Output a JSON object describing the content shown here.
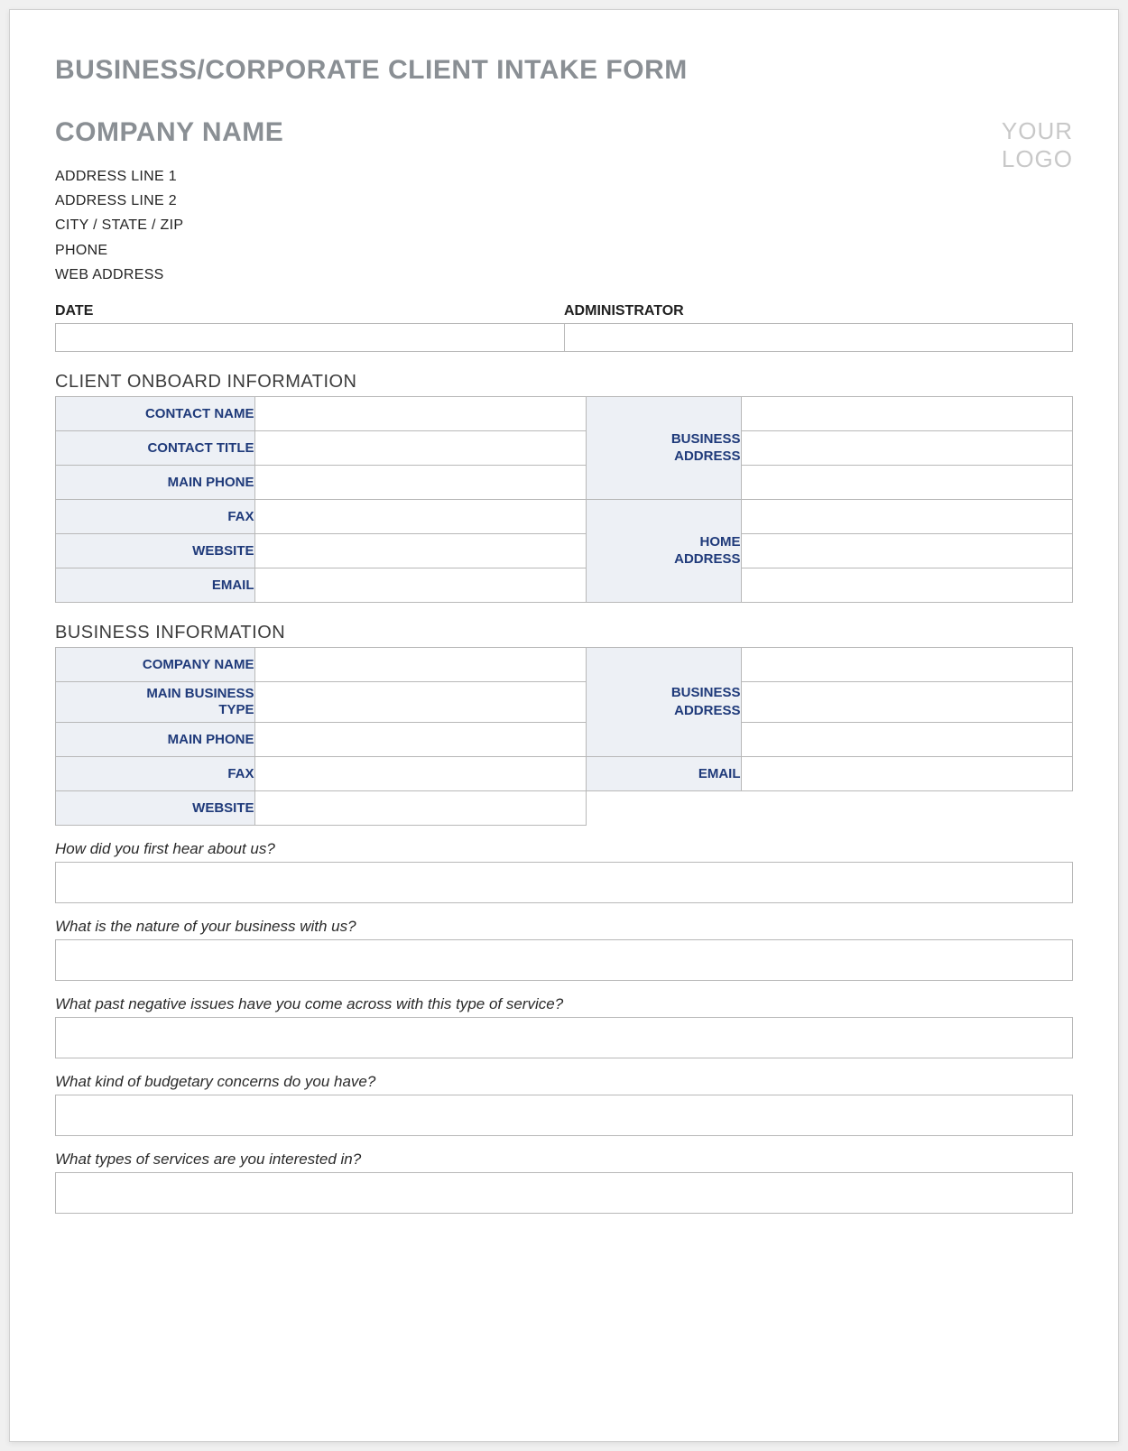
{
  "form_title": "BUSINESS/CORPORATE CLIENT INTAKE FORM",
  "company": {
    "name_label": "COMPANY NAME",
    "address1": "ADDRESS LINE 1",
    "address2": "ADDRESS LINE 2",
    "city_state_zip": "CITY / STATE / ZIP",
    "phone": "PHONE",
    "web": "WEB ADDRESS"
  },
  "logo": {
    "line1": "YOUR",
    "line2": "LOGO"
  },
  "date_admin": {
    "date_label": "DATE",
    "admin_label": "ADMINISTRATOR",
    "date_value": "",
    "admin_value": ""
  },
  "sections": {
    "client_onboard": "CLIENT ONBOARD INFORMATION",
    "business_info": "BUSINESS INFORMATION"
  },
  "client_onboard": {
    "contact_name_label": "CONTACT NAME",
    "contact_title_label": "CONTACT TITLE",
    "main_phone_label": "MAIN PHONE",
    "fax_label": "FAX",
    "website_label": "WEBSITE",
    "email_label": "EMAIL",
    "business_address_label": "BUSINESS\nADDRESS",
    "home_address_label": "HOME\nADDRESS",
    "contact_name": "",
    "contact_title": "",
    "main_phone": "",
    "fax": "",
    "website": "",
    "email": "",
    "business_address_1": "",
    "business_address_2": "",
    "business_address_3": "",
    "home_address_1": "",
    "home_address_2": "",
    "home_address_3": ""
  },
  "business_info": {
    "company_name_label": "COMPANY NAME",
    "main_business_type_label": "MAIN BUSINESS\nTYPE",
    "main_phone_label": "MAIN PHONE",
    "fax_label": "FAX",
    "website_label": "WEBSITE",
    "business_address_label": "BUSINESS\nADDRESS",
    "email_label": "EMAIL",
    "company_name": "",
    "main_business_type": "",
    "main_phone": "",
    "fax": "",
    "website": "",
    "business_address_1": "",
    "business_address_2": "",
    "business_address_3": "",
    "email": ""
  },
  "questions": {
    "q1": "How did you first hear about us?",
    "q2": "What is the nature of your business with us?",
    "q3": "What past negative issues have you come across with this type of service?",
    "q4": "What kind of budgetary concerns do you have?",
    "q5": "What types of services are you interested in?",
    "a1": "",
    "a2": "",
    "a3": "",
    "a4": "",
    "a5": ""
  }
}
